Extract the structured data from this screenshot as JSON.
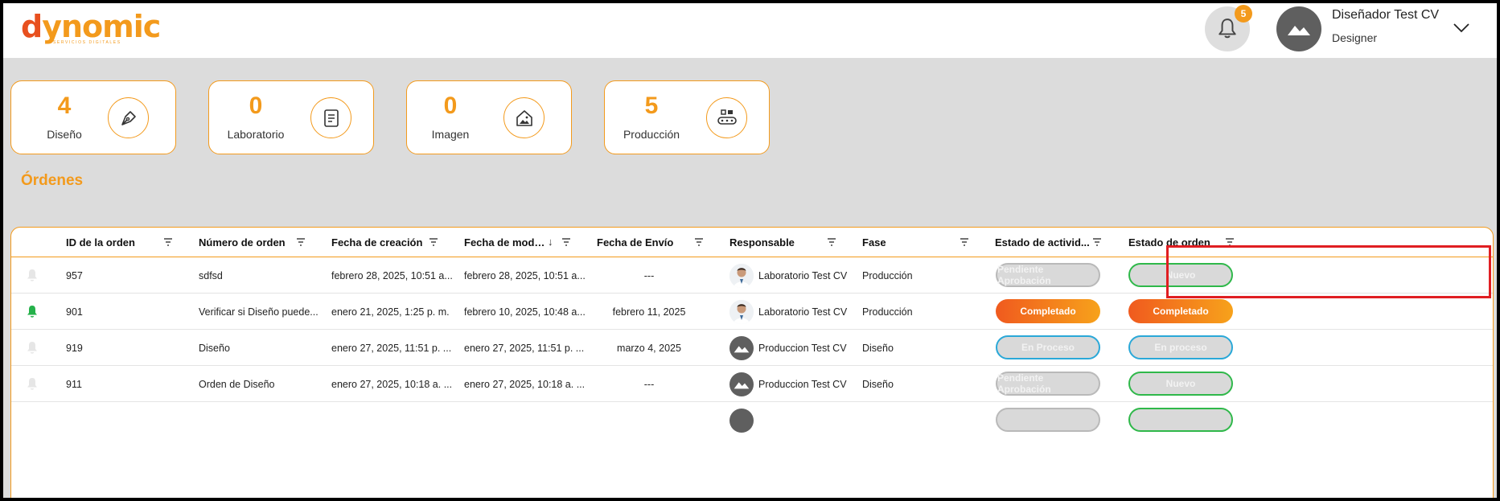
{
  "brand": {
    "name": "dynomic",
    "tagline": "SERVICIOS DIGITALES"
  },
  "header": {
    "notification_count": "5",
    "user_name": "Diseñador Test CV",
    "user_role": "Designer"
  },
  "stats": [
    {
      "value": "4",
      "label": "Diseño",
      "icon": "pen-nib-icon"
    },
    {
      "value": "0",
      "label": "Laboratorio",
      "icon": "document-icon"
    },
    {
      "value": "0",
      "label": "Imagen",
      "icon": "home-image-icon"
    },
    {
      "value": "5",
      "label": "Producción",
      "icon": "machine-icon"
    }
  ],
  "orders_title": "Órdenes",
  "table": {
    "columns": [
      "ID de la orden",
      "Número de orden",
      "Fecha de creación",
      "Fecha de modific...",
      "Fecha de Envío",
      "Responsable",
      "Fase",
      "Estado de activid...",
      "Estado de orden"
    ],
    "rows": [
      {
        "bell": "inactive",
        "id": "957",
        "number": "sdfsd",
        "created": "febrero 28, 2025, 10:51 a...",
        "modified": "febrero 28, 2025, 10:51 a...",
        "sent": "---",
        "responsible": "Laboratorio Test CV",
        "avatar": "photo",
        "phase": "Producción",
        "activity": "Pendiente Aprobación",
        "activity_style": "gray",
        "status": "Nuevo",
        "status_style": "green"
      },
      {
        "bell": "active",
        "id": "901",
        "number": "Verificar si Diseño puede...",
        "created": "enero 21, 2025, 1:25 p. m.",
        "modified": "febrero 10, 2025, 10:48 a...",
        "sent": "febrero 11, 2025",
        "responsible": "Laboratorio Test CV",
        "avatar": "photo",
        "phase": "Producción",
        "activity": "Completado",
        "activity_style": "orange",
        "status": "Completado",
        "status_style": "orange"
      },
      {
        "bell": "inactive",
        "id": "919",
        "number": "Diseño",
        "created": "enero 27, 2025, 11:51 p. ...",
        "modified": "enero 27, 2025, 11:51 p. ...",
        "sent": "marzo 4, 2025",
        "responsible": "Produccion Test CV",
        "avatar": "placeholder",
        "phase": "Diseño",
        "activity": "En Proceso",
        "activity_style": "blue",
        "status": "En proceso",
        "status_style": "blue"
      },
      {
        "bell": "inactive",
        "id": "911",
        "number": "Orden de Diseño",
        "created": "enero 27, 2025, 10:18 a. ...",
        "modified": "enero 27, 2025, 10:18 a. ...",
        "sent": "---",
        "responsible": "Produccion Test CV",
        "avatar": "placeholder",
        "phase": "Diseño",
        "activity": "Pendiente Aprobación",
        "activity_style": "gray",
        "status": "Nuevo",
        "status_style": "green"
      }
    ]
  },
  "colors": {
    "accent": "#f39a1c",
    "highlight": "#e01e22",
    "success": "#2fb84a",
    "info": "#2aa8d8"
  }
}
